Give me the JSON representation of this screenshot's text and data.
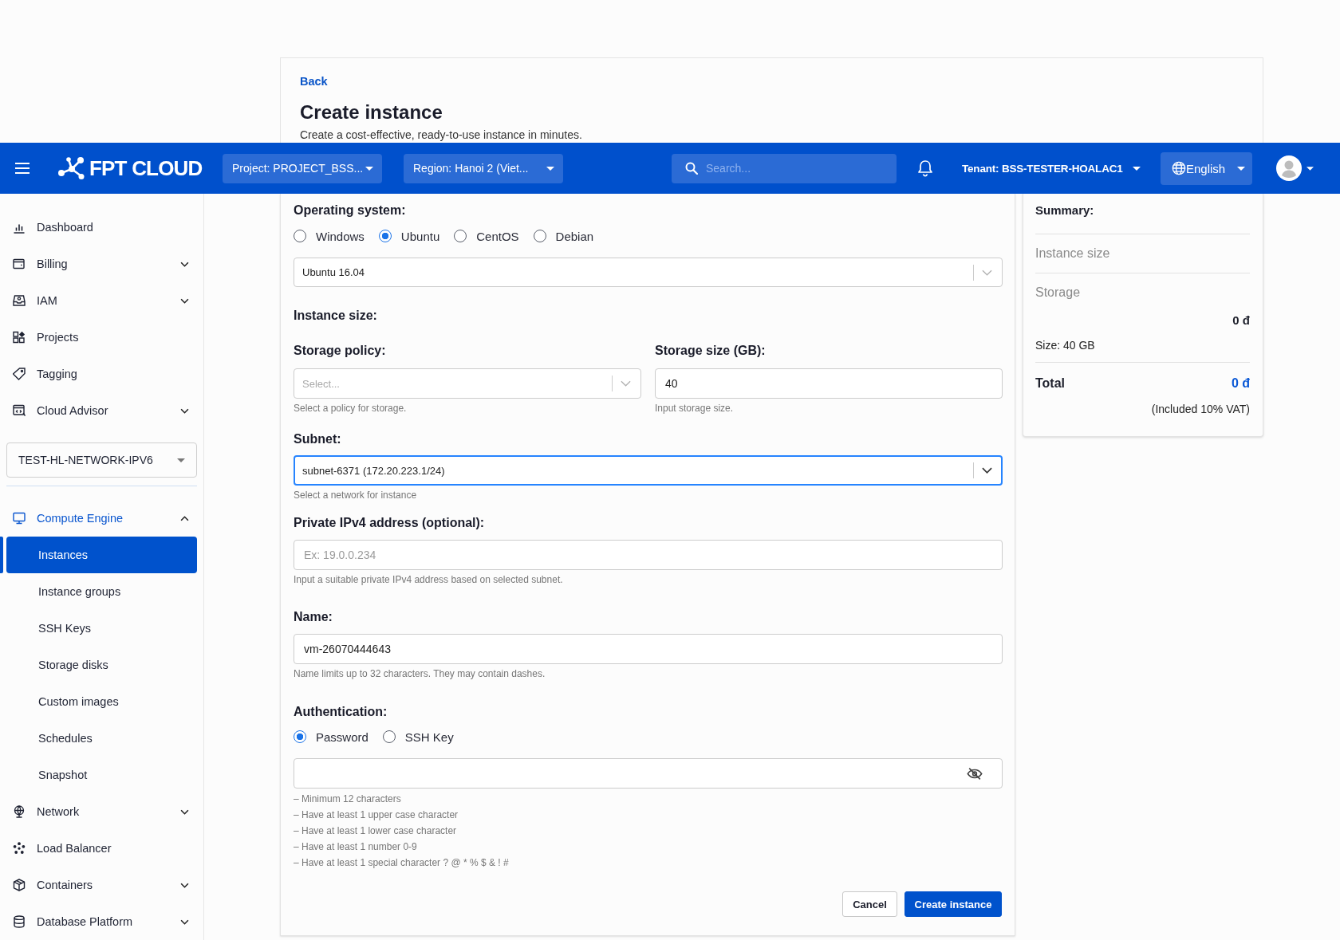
{
  "page_header": {
    "back_link": "Back",
    "title": "Create instance",
    "subtitle": "Create a cost-effective, ready-to-use instance in minutes."
  },
  "top_bar": {
    "logo_text": "FPT CLOUD",
    "project_selector": "Project: PROJECT_BSS...",
    "region_selector": "Region: Hanoi 2 (Viet...",
    "search": {
      "placeholder": "Search..."
    },
    "tenant_selector": "Tenant: BSS-TESTER-HOALAC1",
    "language_selector": "English"
  },
  "sidebar": {
    "items": [
      {
        "label": "Dashboard",
        "kind": "link",
        "selected": false
      },
      {
        "label": "Billing",
        "kind": "group",
        "selected": false,
        "expanded": false
      },
      {
        "label": "IAM",
        "kind": "group",
        "selected": false,
        "expanded": false
      },
      {
        "label": "Projects",
        "kind": "link",
        "selected": false
      },
      {
        "label": "Tagging",
        "kind": "link",
        "selected": false
      },
      {
        "label": "Cloud Advisor",
        "kind": "group",
        "selected": false,
        "expanded": false
      }
    ],
    "project_select": {
      "value": "TEST-HL-NETWORK-IPV6"
    },
    "services": [
      {
        "label": "Compute Engine",
        "kind": "group",
        "selected": false,
        "expanded": true,
        "children": [
          {
            "label": "Instances",
            "selected": true
          },
          {
            "label": "Instance groups",
            "selected": false
          },
          {
            "label": "SSH Keys",
            "selected": false
          },
          {
            "label": "Storage disks",
            "selected": false
          },
          {
            "label": "Custom images",
            "selected": false
          },
          {
            "label": "Schedules",
            "selected": false
          },
          {
            "label": "Snapshot",
            "selected": false
          }
        ]
      },
      {
        "label": "Network",
        "kind": "group",
        "selected": false,
        "expanded": false
      },
      {
        "label": "Load Balancer",
        "kind": "link",
        "selected": false
      },
      {
        "label": "Containers",
        "kind": "group",
        "selected": false,
        "expanded": false
      },
      {
        "label": "Database Platform",
        "kind": "group",
        "selected": false,
        "expanded": false
      }
    ]
  },
  "form": {
    "os": {
      "label": "Operating system:",
      "options": [
        {
          "label": "Windows",
          "selected": false
        },
        {
          "label": "Ubuntu",
          "selected": true
        },
        {
          "label": "CentOS",
          "selected": false
        },
        {
          "label": "Debian",
          "selected": false
        }
      ],
      "version_select": {
        "value": "Ubuntu 16.04",
        "focused": false
      }
    },
    "instance_size": {
      "label": "Instance size:"
    },
    "storage_policy": {
      "label": "Storage policy:",
      "placeholder": "Select...",
      "focused": false,
      "help": "Select a policy for storage."
    },
    "storage_size": {
      "label": "Storage size (GB):",
      "value": "40",
      "help": "Input storage size."
    },
    "subnet": {
      "label": "Subnet:",
      "value": "subnet-6371 (172.20.223.1/24)",
      "focused": true,
      "help": "Select a network for instance"
    },
    "private_ip": {
      "label": "Private IPv4 address (optional):",
      "placeholder": "Ex: 19.0.0.234",
      "help": "Input a suitable private IPv4 address based on selected subnet."
    },
    "name": {
      "label": "Name:",
      "value": "vm-26070444643",
      "help": "Name limits up to 32 characters. They may contain dashes."
    },
    "authentication": {
      "label": "Authentication:",
      "options": [
        {
          "label": "Password",
          "selected": true
        },
        {
          "label": "SSH Key",
          "selected": false
        }
      ],
      "password_rules": [
        "– Minimum 12 characters",
        "– Have at least 1 upper case character",
        "– Have at least 1 lower case character",
        "– Have at least 1 number 0-9",
        "– Have at least 1 special character ? @ * % $ & ! #"
      ]
    },
    "buttons": [
      {
        "label": "Cancel",
        "kind": "secondary"
      },
      {
        "label": "Create instance",
        "kind": "primary"
      }
    ]
  },
  "summary": {
    "title": "Summary:",
    "instance_size": "Instance size",
    "storage": {
      "label": "Storage",
      "price": "0 đ",
      "detail": "Size: 40 GB"
    },
    "total": {
      "label": "Total",
      "price": "0 đ",
      "note": "(Included 10% VAT)"
    }
  }
}
